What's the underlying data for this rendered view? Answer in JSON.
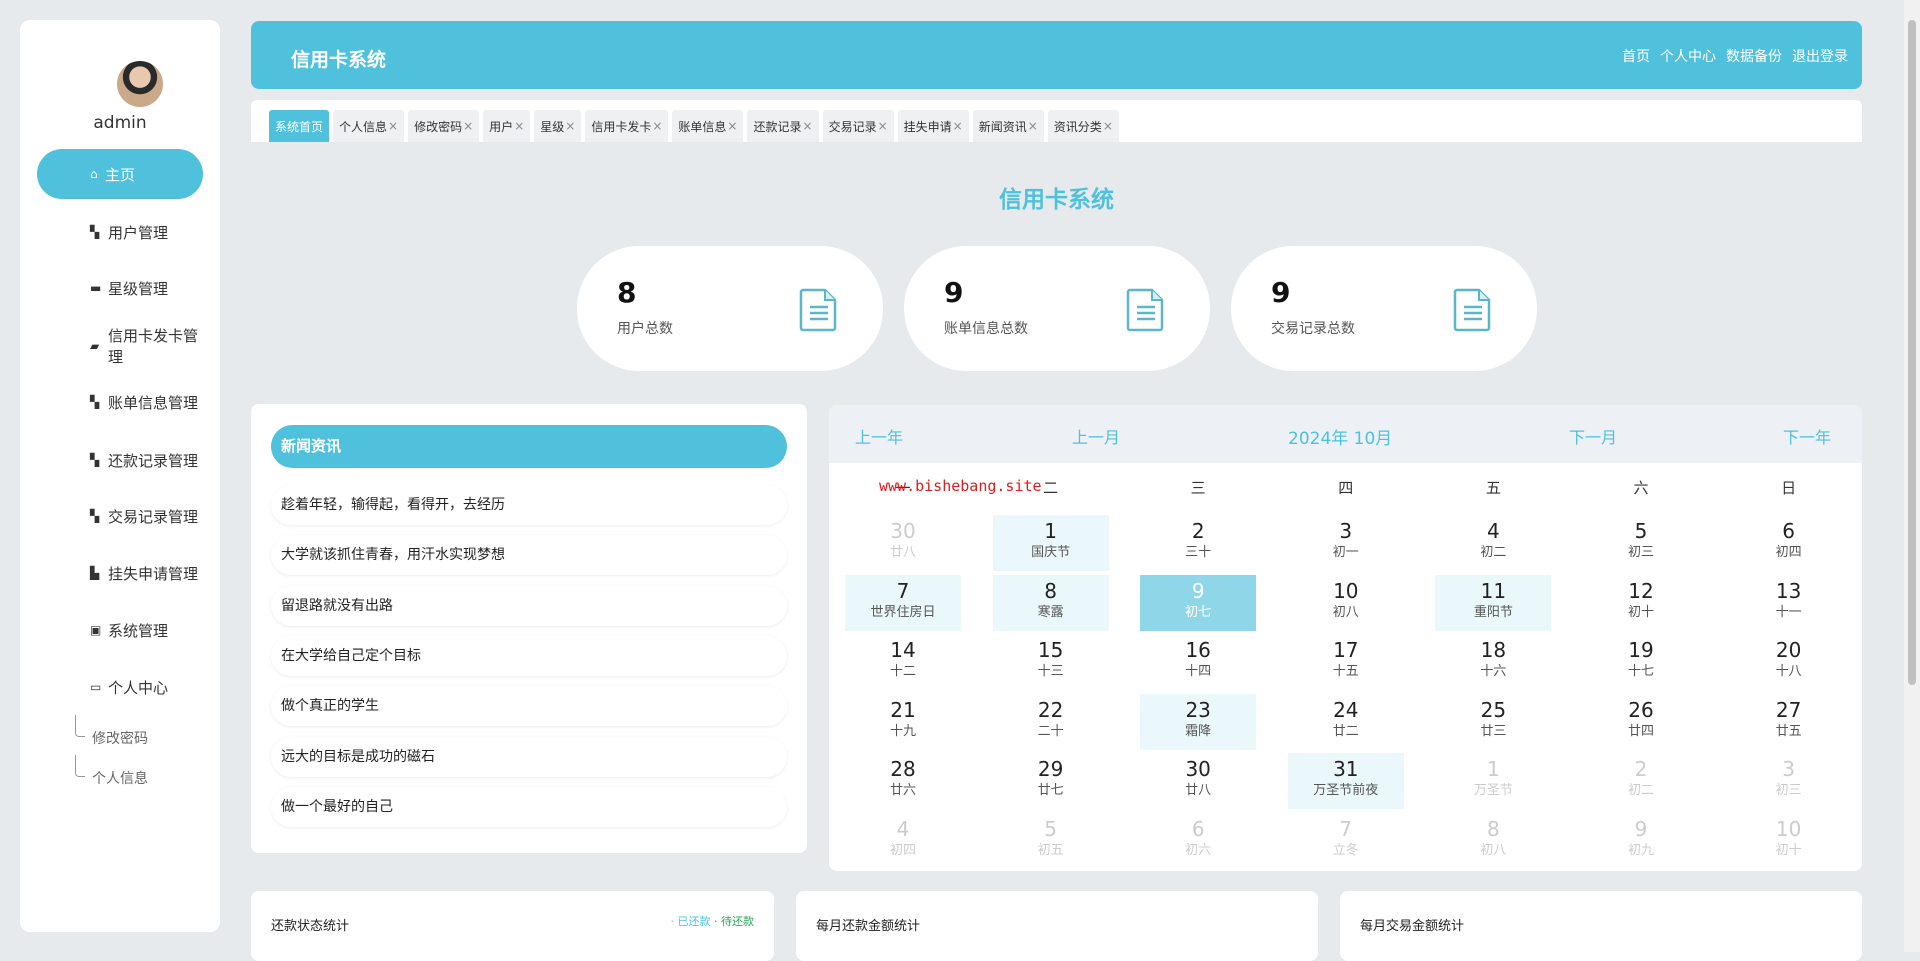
{
  "sidebar": {
    "username": "admin",
    "items": [
      {
        "label": "主页",
        "icon": "home-icon"
      },
      {
        "label": "用户管理",
        "icon": "grid-icon"
      },
      {
        "label": "星级管理",
        "icon": "briefcase-icon"
      },
      {
        "label": "信用卡发卡管理",
        "icon": "wallet-icon"
      },
      {
        "label": "账单信息管理",
        "icon": "grid-icon"
      },
      {
        "label": "还款记录管理",
        "icon": "grid-icon"
      },
      {
        "label": "交易记录管理",
        "icon": "grid-icon"
      },
      {
        "label": "挂失申请管理",
        "icon": "ticket-icon"
      },
      {
        "label": "系统管理",
        "icon": "clipboard-icon"
      },
      {
        "label": "个人中心",
        "icon": "card-icon"
      }
    ],
    "sub": [
      "修改密码",
      "个人信息"
    ]
  },
  "header": {
    "title": "信用卡系统",
    "nav": [
      "首页",
      "个人中心",
      "数据备份",
      "退出登录"
    ]
  },
  "tabs": [
    "系统首页",
    "个人信息",
    "修改密码",
    "用户",
    "星级",
    "信用卡发卡",
    "账单信息",
    "还款记录",
    "交易记录",
    "挂失申请",
    "新闻资讯",
    "资讯分类"
  ],
  "tab_close": "×",
  "page_title": "信用卡系统",
  "stats": [
    {
      "value": "8",
      "label": "用户总数"
    },
    {
      "value": "9",
      "label": "账单信息总数"
    },
    {
      "value": "9",
      "label": "交易记录总数"
    }
  ],
  "news": {
    "title": "新闻资讯",
    "items": [
      "趁着年轻，输得起，看得开，去经历",
      "大学就该抓住青春，用汗水实现梦想",
      "留退路就没有出路",
      "在大学给自己定个目标",
      "做个真正的学生",
      "远大的目标是成功的磁石",
      "做一个最好的自己"
    ]
  },
  "calendar": {
    "prev_year": "上一年",
    "prev_month": "上一月",
    "current": "2024年 10月",
    "next_month": "下一月",
    "next_year": "下一年",
    "weekdays": [
      "一",
      "二",
      "三",
      "四",
      "五",
      "六",
      "日"
    ],
    "watermark": "www.bishebang.site",
    "days": [
      [
        "30",
        "廿八",
        "other"
      ],
      [
        "1",
        "国庆节",
        "hl"
      ],
      [
        "2",
        "三十",
        ""
      ],
      [
        "3",
        "初一",
        ""
      ],
      [
        "4",
        "初二",
        ""
      ],
      [
        "5",
        "初三",
        ""
      ],
      [
        "6",
        "初四",
        ""
      ],
      [
        "7",
        "世界住房日",
        "hl"
      ],
      [
        "8",
        "寒露",
        "hl"
      ],
      [
        "9",
        "初七",
        "sel"
      ],
      [
        "10",
        "初八",
        ""
      ],
      [
        "11",
        "重阳节",
        "hl"
      ],
      [
        "12",
        "初十",
        ""
      ],
      [
        "13",
        "十一",
        ""
      ],
      [
        "14",
        "十二",
        ""
      ],
      [
        "15",
        "十三",
        ""
      ],
      [
        "16",
        "十四",
        ""
      ],
      [
        "17",
        "十五",
        ""
      ],
      [
        "18",
        "十六",
        ""
      ],
      [
        "19",
        "十七",
        ""
      ],
      [
        "20",
        "十八",
        ""
      ],
      [
        "21",
        "十九",
        ""
      ],
      [
        "22",
        "二十",
        ""
      ],
      [
        "23",
        "霜降",
        "hl"
      ],
      [
        "24",
        "廿二",
        ""
      ],
      [
        "25",
        "廿三",
        ""
      ],
      [
        "26",
        "廿四",
        ""
      ],
      [
        "27",
        "廿五",
        ""
      ],
      [
        "28",
        "廿六",
        ""
      ],
      [
        "29",
        "廿七",
        ""
      ],
      [
        "30",
        "廿八",
        ""
      ],
      [
        "31",
        "万圣节前夜",
        "hl"
      ],
      [
        "1",
        "万圣节",
        "other"
      ],
      [
        "2",
        "初二",
        "other"
      ],
      [
        "3",
        "初三",
        "other"
      ],
      [
        "4",
        "初四",
        "other"
      ],
      [
        "5",
        "初五",
        "other"
      ],
      [
        "6",
        "初六",
        "other"
      ],
      [
        "7",
        "立冬",
        "other"
      ],
      [
        "8",
        "初八",
        "other"
      ],
      [
        "9",
        "初九",
        "other"
      ],
      [
        "10",
        "初十",
        "other"
      ]
    ]
  },
  "bottom": [
    {
      "title": "还款状态统计",
      "legend": [
        "已还款",
        "待还款"
      ]
    },
    {
      "title": "每月还款金额统计"
    },
    {
      "title": "每月交易金额统计"
    }
  ],
  "colors": {
    "accent": "#4fc1dd",
    "legend_paid": "#4fc1dd",
    "legend_pending": "#2aa55a"
  }
}
